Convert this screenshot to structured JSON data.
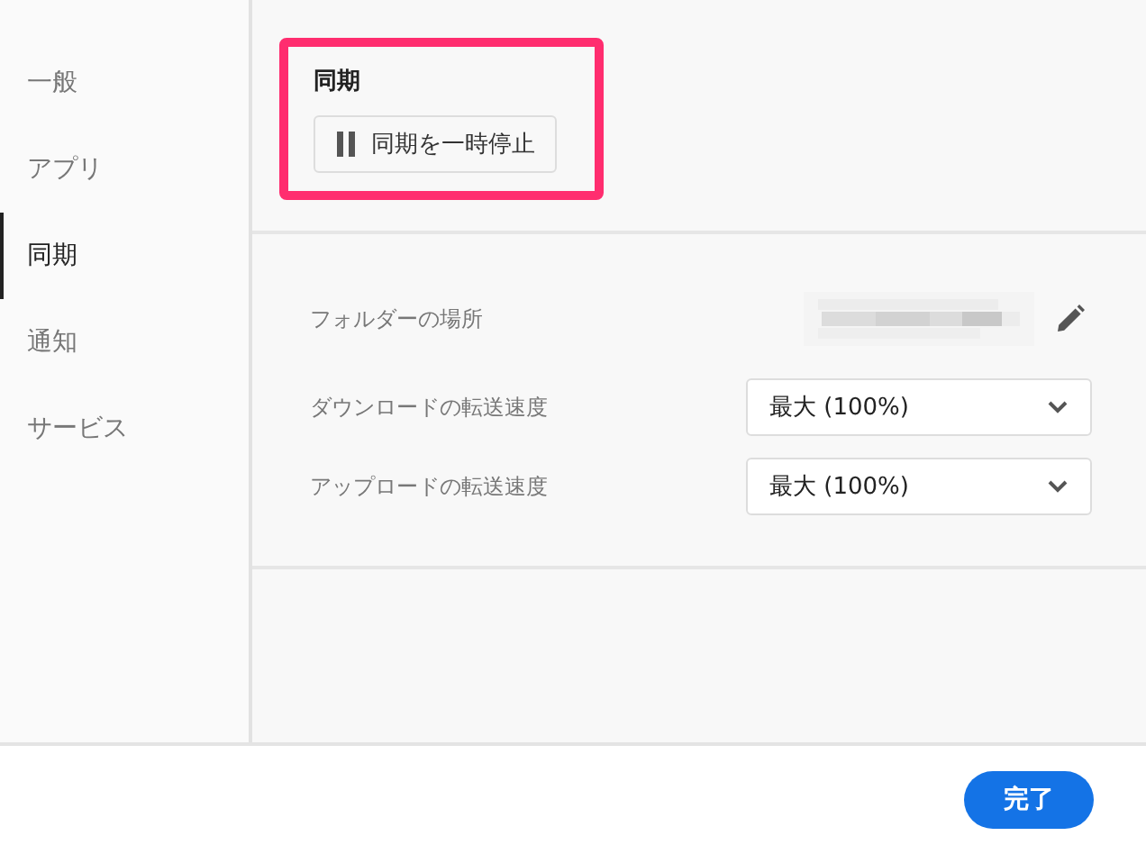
{
  "sidebar": {
    "items": [
      {
        "label": "一般",
        "selected": false
      },
      {
        "label": "アプリ",
        "selected": false
      },
      {
        "label": "同期",
        "selected": true
      },
      {
        "label": "通知",
        "selected": false
      },
      {
        "label": "サービス",
        "selected": false
      }
    ]
  },
  "sync_section": {
    "title": "同期",
    "pause_button": "同期を一時停止",
    "highlighted": true
  },
  "settings": [
    {
      "kind": "path",
      "label": "フォルダーの場所"
    },
    {
      "kind": "dropdown",
      "label": "ダウンロードの転送速度",
      "value": "最大 (100%)"
    },
    {
      "kind": "dropdown",
      "label": "アップロードの転送速度",
      "value": "最大 (100%)"
    }
  ],
  "footer": {
    "done_button": "完了"
  }
}
